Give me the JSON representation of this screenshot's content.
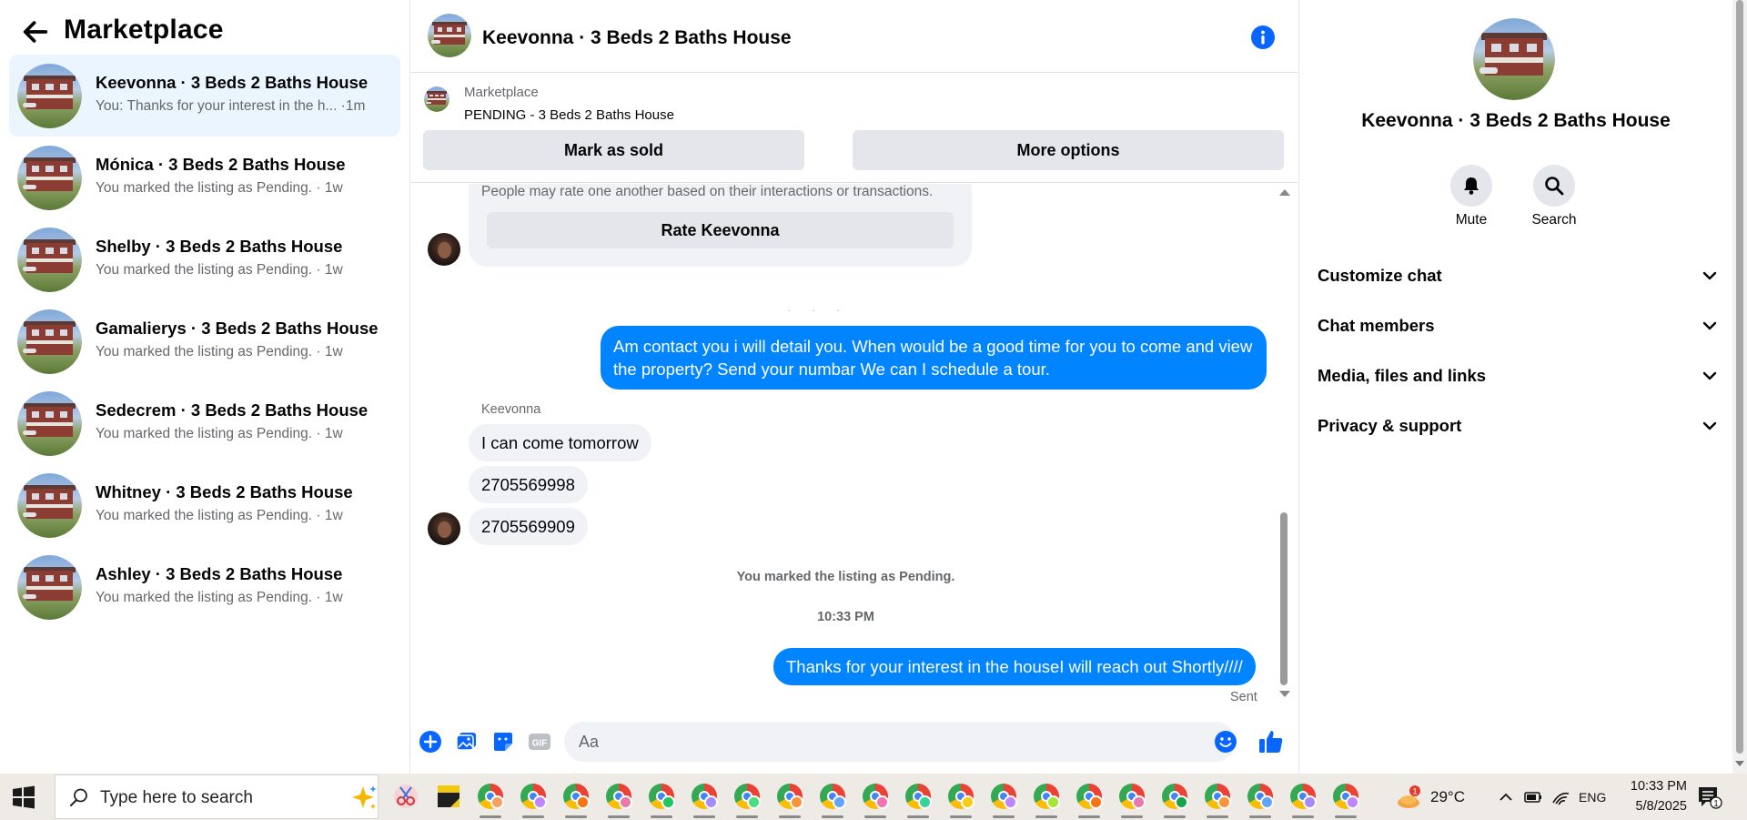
{
  "left": {
    "title": "Marketplace",
    "conversations": [
      {
        "name": "Keevonna · 3 Beds 2 Baths House",
        "preview": "You: Thanks for your interest in the h... ·1m"
      },
      {
        "name": "Mónica · 3 Beds 2 Baths House",
        "preview": "You marked the listing as Pending. · 1w"
      },
      {
        "name": "Shelby · 3 Beds 2 Baths House",
        "preview": "You marked the listing as Pending. · 1w"
      },
      {
        "name": "Gamalierys · 3 Beds 2 Baths House",
        "preview": "You marked the listing as Pending. · 1w"
      },
      {
        "name": "Sedecrem · 3 Beds 2 Baths House",
        "preview": "You marked the listing as Pending. · 1w"
      },
      {
        "name": "Whitney · 3 Beds 2 Baths House",
        "preview": "You marked the listing as Pending. · 1w"
      },
      {
        "name": "Ashley · 3 Beds 2 Baths House",
        "preview": "You marked the listing as Pending. · 1w"
      }
    ]
  },
  "chat": {
    "title": "Keevonna · 3 Beds 2 Baths House",
    "marketplace_label": "Marketplace",
    "listing_status": "PENDING - 3 Beds 2 Baths House",
    "mark_sold_label": "Mark as sold",
    "more_options_label": "More options",
    "rate_note": "People may rate one another based on their interactions or transactions.",
    "rate_button": "Rate Keevonna",
    "outgoing_1": "Am contact you i will detail you.  When would be a good time for you to come and view the property? Send your numbar We can I schedule a tour.",
    "sender_name": "Keevonna",
    "incoming": [
      "I can come tomorrow",
      "2705569998",
      "2705569909"
    ],
    "system_note": "You marked the listing as Pending.",
    "timestamp": "10:33 PM",
    "outgoing_2": "Thanks for your interest in the houseI will reach out Shortly////",
    "sent_status": "Sent",
    "input_placeholder": "Aa"
  },
  "right": {
    "title": "Keevonna · 3 Beds 2 Baths House",
    "mute_label": "Mute",
    "search_label": "Search",
    "sections": [
      "Customize chat",
      "Chat members",
      "Media, files and links",
      "Privacy & support"
    ]
  },
  "taskbar": {
    "search_placeholder": "Type here to search",
    "temperature": "29°C",
    "language": "ENG",
    "time": "10:33 PM",
    "date": "5/8/2025",
    "weather_badge": "1",
    "notification_badge": "1"
  },
  "colors": {
    "accent": "#0084ff",
    "active_row": "#ebf5ff",
    "bubble_in": "#f0f2f5"
  }
}
